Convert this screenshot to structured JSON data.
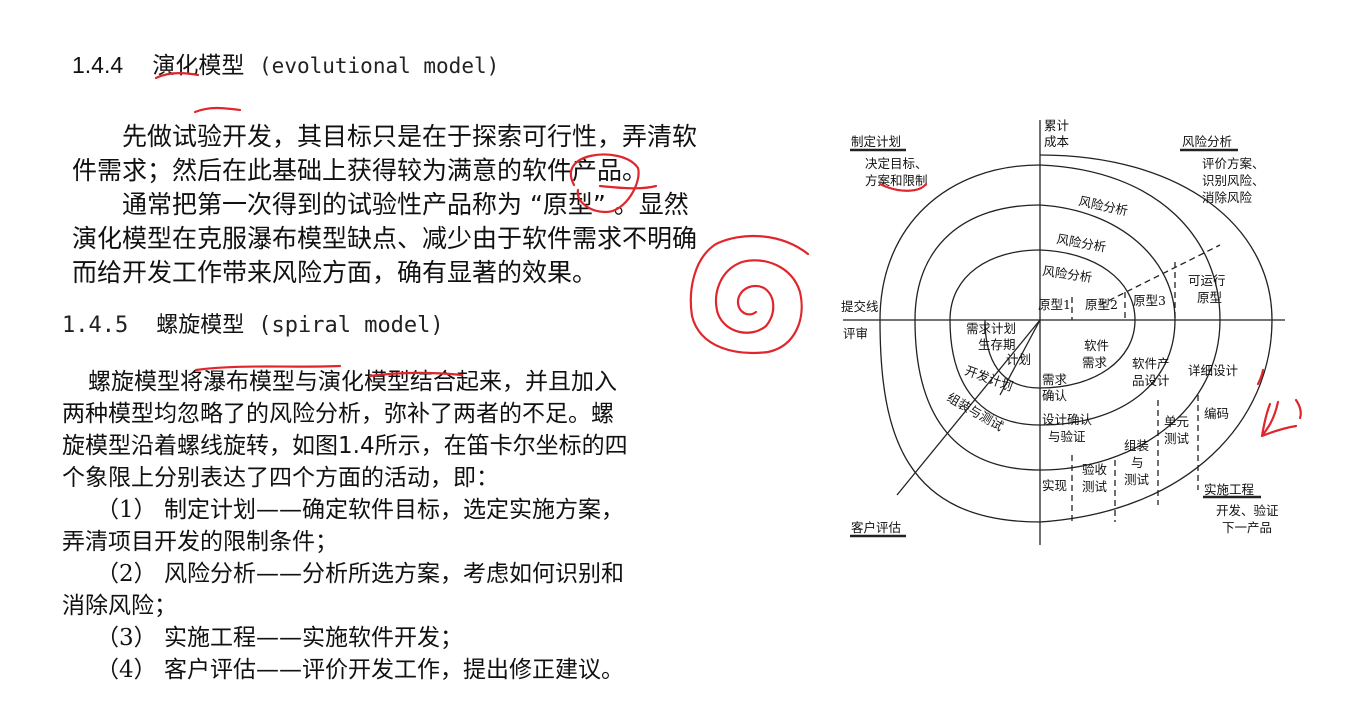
{
  "sec1": {
    "num": "1.4.4",
    "title": "演化模型",
    "en": "(evolutional model)"
  },
  "para1": [
    "先做试验开发，其目标只是在于探索可行性，弄清软",
    "件需求；然后在此基础上获得较为满意的软件产品。",
    "通常把第一次得到的试验性产品称为 “原型” 。显然",
    "演化模型在克服瀑布模型缺点、减少由于软件需求不明确",
    "而给开发工作带来风险方面，确有显著的效果。"
  ],
  "sec2": {
    "num": "1.4.5",
    "title": "螺旋模型",
    "en": "(spiral model)"
  },
  "para2": {
    "lines": [
      "螺旋模型将瀑布模型与演化模型结合起来，并且加入",
      "两种模型均忽略了的风险分析，弥补了两者的不足。螺",
      "旋模型沿着螺线旋转，如图1.4所示，在笛卡尔坐标的四",
      "个象限上分别表达了四个方面的活动，即："
    ],
    "items": [
      {
        "idx": "（1）",
        "text": "制定计划——确定软件目标，选定实施方案，",
        "cont": "弄清项目开发的限制条件；"
      },
      {
        "idx": "（2）",
        "text": "风险分析——分析所选方案，考虑如何识别和",
        "cont": "消除风险；"
      },
      {
        "idx": "（3）",
        "text": "实施工程——实施软件开发；"
      },
      {
        "idx": "（4）",
        "text": "客户评估——评价开发工作，提出修正建议。"
      }
    ]
  },
  "diagram": {
    "quadrants": {
      "plan": "制定计划",
      "plan_sub": [
        "决定目标、",
        "方案和限制"
      ],
      "risk": "风险分析",
      "risk_sub": [
        "评价方案、",
        "识别风险、",
        "消除风险"
      ],
      "engineering": "实施工程",
      "engineering_sub": [
        "开发、验证",
        "下一产品"
      ],
      "customer": "客户评估"
    },
    "axis_top": [
      "累计",
      "成本"
    ],
    "axis_left": [
      "提交线",
      "评审"
    ],
    "risk_labels": [
      "风险分析",
      "风险分析",
      "风险分析"
    ],
    "prototypes": [
      "原型1",
      "原型2",
      "原型3"
    ],
    "runnable": [
      "可运行",
      "原型"
    ],
    "plans": [
      "需求计划",
      "生存期",
      "计划",
      "开发计划",
      "组装与测试"
    ],
    "steps": [
      "软件",
      "需求",
      "软件产",
      "品设计",
      "详细设计",
      "需求",
      "确认",
      "设计确认",
      "与验证",
      "单元",
      "测试",
      "编码",
      "组装",
      "与",
      "测试",
      "验收",
      "测试",
      "实现"
    ]
  }
}
